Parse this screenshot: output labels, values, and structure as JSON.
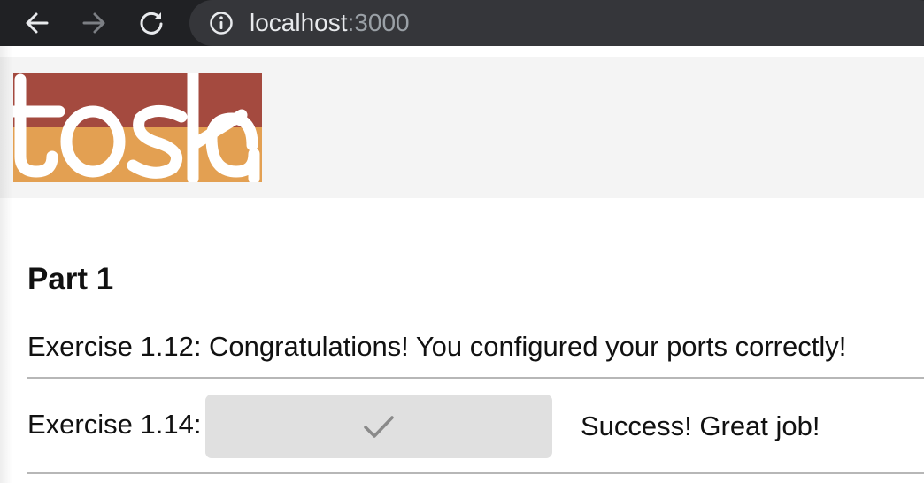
{
  "browser": {
    "url_host": "localhost",
    "url_port": ":3000",
    "icons": {
      "back": "arrow-left-icon",
      "forward": "arrow-right-icon",
      "reload": "reload-icon",
      "site_info": "info-icon"
    }
  },
  "header": {
    "logo_text": "tosk",
    "logo_colors": {
      "top": "#a44a3f",
      "bottom": "#e3a052",
      "band": "#f4f4f4"
    }
  },
  "main": {
    "part_title": "Part 1",
    "exercises": [
      {
        "label": "Exercise 1.12: Congratulations! You configured your ports correctly!"
      },
      {
        "label": "Exercise 1.14:",
        "button_icon": "checkmark-icon",
        "status": "Success! Great job!"
      }
    ]
  }
}
